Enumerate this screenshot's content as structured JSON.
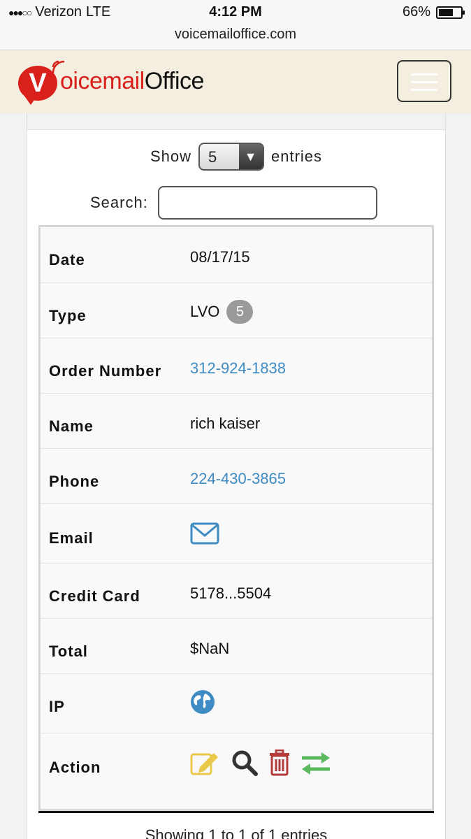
{
  "status_bar": {
    "carrier": "Verizon",
    "network": "LTE",
    "time": "4:12 PM",
    "battery": "66%",
    "battery_level": 0.66,
    "url": "voicemailoffice.com"
  },
  "header": {
    "logo_initial": "V",
    "logo_text_1": "oicemail",
    "logo_text_2": "Office",
    "brand_color": "#d9201b"
  },
  "table_controls": {
    "show_label": "Show",
    "entries_value": "5",
    "entries_label": "entries",
    "search_label": "Search:",
    "search_value": ""
  },
  "record": {
    "date_label": "Date",
    "date_value": "08/17/15",
    "type_label": "Type",
    "type_value": "LVO",
    "type_badge": "5",
    "order_label": "Order Number",
    "order_value": "312-924-1838",
    "name_label": "Name",
    "name_value": "rich kaiser",
    "phone_label": "Phone",
    "phone_value": "224-430-3865",
    "email_label": "Email",
    "email_icon": "envelope-icon",
    "card_label": "Credit Card",
    "card_value": "5178...5504",
    "total_label": "Total",
    "total_value": "$NaN",
    "ip_label": "IP",
    "ip_icon": "globe-icon",
    "action_label": "Action",
    "actions": [
      "edit-icon",
      "search-icon",
      "trash-icon",
      "transfer-icon"
    ]
  },
  "colors": {
    "link": "#3f8bc3",
    "edit": "#e9c84a",
    "delete": "#b23a3a",
    "transfer": "#5cb85c"
  },
  "footer": {
    "info": "Showing 1 to 1 of 1 entries"
  }
}
